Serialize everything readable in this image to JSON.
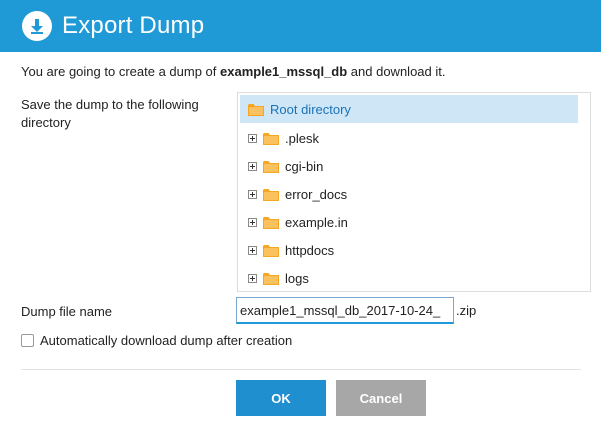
{
  "dialog": {
    "title": "Export Dump"
  },
  "intro": {
    "prefix": "You are going to create a dump of ",
    "db_name": "example1_mssql_db",
    "suffix": " and download it."
  },
  "directory": {
    "label": "Save the dump to the following directory",
    "root": "Root directory",
    "items": [
      ".plesk",
      "cgi-bin",
      "error_docs",
      "example.in",
      "httpdocs",
      "logs"
    ]
  },
  "file_name": {
    "label": "Dump file name",
    "value": "example1_mssql_db_2017-10-24_",
    "suffix": ".zip"
  },
  "auto_download": {
    "label": "Automatically download dump after creation",
    "checked": false
  },
  "buttons": {
    "ok": "OK",
    "cancel": "Cancel"
  },
  "colors": {
    "header": "#1f9ad6",
    "selected_row": "#cfe6f7",
    "folder": "#f5a623",
    "ok": "#1f8fd0",
    "cancel": "#a7a7a7"
  }
}
